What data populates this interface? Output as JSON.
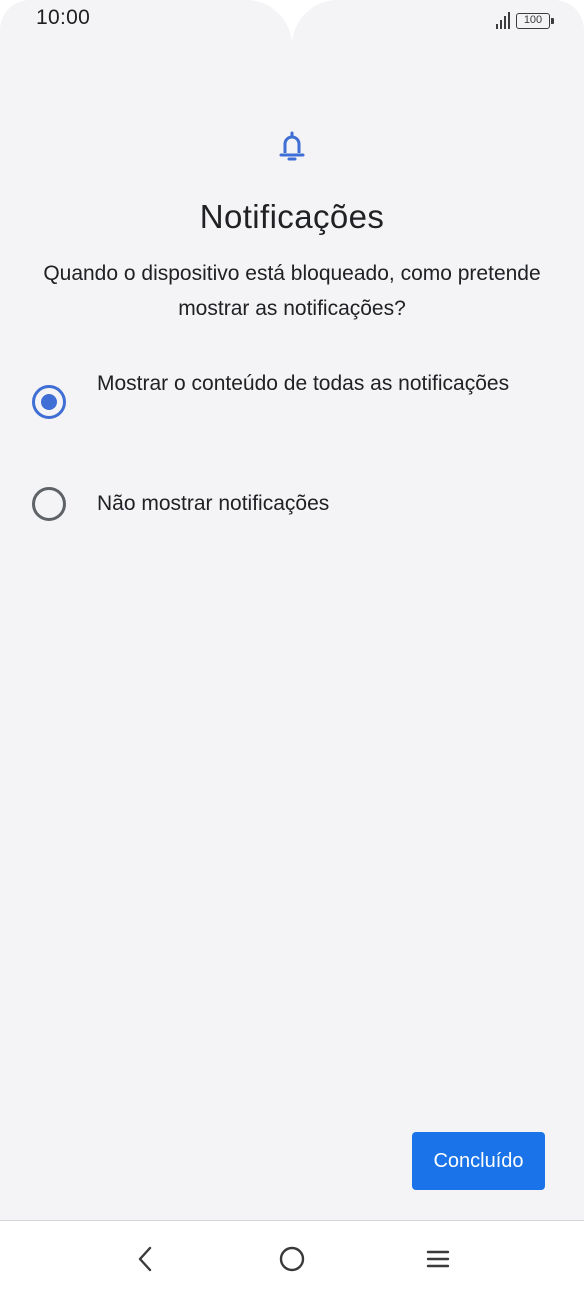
{
  "status_bar": {
    "time": "10:00",
    "battery_level": "100",
    "signal_icon": "signal-bars-icon",
    "battery_icon": "battery-icon"
  },
  "page": {
    "icon": "bell-icon",
    "title": "Notificações",
    "subtitle": "Quando o dispositivo está bloqueado, como pretende mostrar as notificações?"
  },
  "options": [
    {
      "label": "Mostrar o conteúdo de todas as notificações",
      "selected": true
    },
    {
      "label": "Não mostrar notificações",
      "selected": false
    }
  ],
  "actions": {
    "done_label": "Concluído"
  },
  "nav_bar": {
    "back_icon": "back-chevron-icon",
    "home_icon": "home-circle-icon",
    "menu_icon": "menu-lines-icon"
  },
  "colors": {
    "accent": "#3f6ed4",
    "button": "#1a73e8",
    "background": "#f4f4f6"
  }
}
